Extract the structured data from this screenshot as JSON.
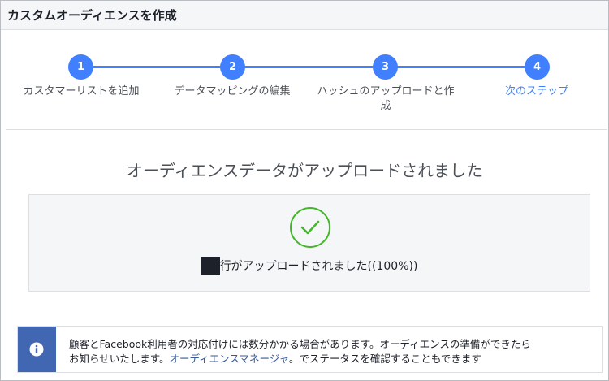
{
  "header": {
    "title": "カスタムオーディエンスを作成"
  },
  "stepper": {
    "steps": [
      {
        "number": "1",
        "label": "カスタマーリストを追加"
      },
      {
        "number": "2",
        "label": "データマッピングの編集"
      },
      {
        "number": "3",
        "label_line1": "ハッシュのアップロードと作",
        "label_line2": "成"
      },
      {
        "number": "4",
        "label": "次のステップ"
      }
    ],
    "accent_color": "#4080ff"
  },
  "result": {
    "title": "オーディエンスデータがアップロードされました",
    "message": "行がアップロードされました((100%))",
    "check_color": "#42b72a"
  },
  "info": {
    "icon": "info-icon",
    "text_line1": "顧客とFacebook利用者の対応付けには数分かかる場合があります。オーディエンスの準備ができたら",
    "text_line2_prefix": "お知らせいたします。",
    "link_label": "オーディエンスマネージャ",
    "text_line2_suffix": "。でステータスを確認することもできます"
  }
}
